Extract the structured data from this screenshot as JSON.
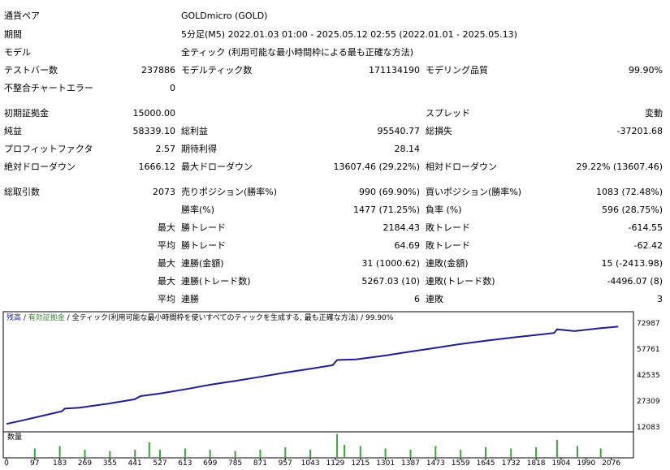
{
  "report": {
    "symbol": {
      "label": "通貨ペア",
      "value": "GOLDmicro (GOLD)"
    },
    "period": {
      "label": "期間",
      "value": "5分足(M5) 2022.01.03 01:00 - 2025.05.12 02:55 (2022.01.01 - 2025.05.13)"
    },
    "model": {
      "label": "モデル",
      "value": "全ティック (利用可能な最小時間枠による最も正確な方法)"
    },
    "bars": {
      "label": "テストバー数",
      "value": "237886"
    },
    "ticks": {
      "label": "モデルティック数",
      "value": "171134190"
    },
    "quality": {
      "label": "モデリング品質",
      "value": "99.90%"
    },
    "mismatch": {
      "label": "不整合チャートエラー",
      "value": "0"
    },
    "deposit": {
      "label": "初期証拠金",
      "value": "15000.00"
    },
    "spread": {
      "label": "スプレッド",
      "value": "変動"
    },
    "net_profit": {
      "label": "純益",
      "value": "58339.10"
    },
    "gross_profit": {
      "label": "総利益",
      "value": "95540.77"
    },
    "gross_loss": {
      "label": "総損失",
      "value": "-37201.68"
    },
    "profit_factor": {
      "label": "プロフィットファクタ",
      "value": "2.57"
    },
    "expected_payoff": {
      "label": "期待利得",
      "value": "28.14"
    },
    "abs_dd": {
      "label": "絶対ドローダウン",
      "value": "1666.12"
    },
    "max_dd": {
      "label": "最大ドローダウン",
      "value": "13607.46 (29.22%)"
    },
    "rel_dd": {
      "label": "相対ドローダウン",
      "value": "29.22% (13607.46)"
    },
    "total_trades": {
      "label": "総取引数",
      "value": "2073"
    },
    "short_pos": {
      "label": "売りポジション(勝率%)",
      "value": "990 (69.90%)"
    },
    "long_pos": {
      "label": "買いポジション(勝率%)",
      "value": "1083 (72.48%)"
    },
    "win_rate": {
      "label": "勝率(%)",
      "value": "1477 (71.25%)"
    },
    "loss_rate": {
      "label": "負率 (%)",
      "value": "596 (28.75%)"
    },
    "largest_win": {
      "prefix": "最大",
      "label": "勝トレード",
      "value": "2184.43"
    },
    "largest_loss": {
      "label": "敗トレード",
      "value": "-614.55"
    },
    "avg_win": {
      "prefix": "平均",
      "label": "勝トレード",
      "value": "64.69"
    },
    "avg_loss": {
      "label": "敗トレード",
      "value": "-62.42"
    },
    "max_consec_wins_amt": {
      "prefix": "最大",
      "label": "連勝(金額)",
      "value": "31 (1000.62)"
    },
    "max_consec_loss_amt": {
      "label": "連敗(金額)",
      "value": "15 (-2413.98)"
    },
    "max_consec_wins_cnt": {
      "prefix": "最大",
      "label": "連勝(トレード数)",
      "value": "5267.03 (10)"
    },
    "max_consec_loss_cnt": {
      "label": "連敗(トレード数)",
      "value": "-4496.07 (8)"
    },
    "avg_consec_wins": {
      "prefix": "平均",
      "label": "連勝",
      "value": "6"
    },
    "avg_consec_loss": {
      "label": "連敗",
      "value": "3"
    }
  },
  "chart": {
    "legend_balance": "残高",
    "legend_sep1": " / ",
    "legend_equity": "有効証拠金",
    "legend_sep2": " / ",
    "legend_model": "全ティック(利用可能な最小時間枠を使いすべてのティックを生成する, 最も正確な方法)",
    "legend_sep3": " / ",
    "legend_quality": "99.90%",
    "volume_label": "数量",
    "colors": {
      "balance": "#1e1e8c",
      "equity": "#2e8b2e",
      "volume": "#3aa63a",
      "axis": "#000000"
    }
  },
  "chart_data": {
    "type": "line",
    "y_ticks": [
      "72987",
      "57761",
      "42535",
      "27309",
      "12083"
    ],
    "x_ticks": [
      "0",
      "97",
      "183",
      "269",
      "355",
      "441",
      "527",
      "613",
      "699",
      "785",
      "871",
      "957",
      "1043",
      "1129",
      "1215",
      "1301",
      "1387",
      "1473",
      "1559",
      "1645",
      "1732",
      "1818",
      "1904",
      "1990",
      "2076"
    ],
    "ylim": [
      12083,
      80000
    ],
    "xlim": [
      0,
      2130
    ],
    "series": [
      {
        "x": [
          0,
          50,
          120,
          190,
          200,
          250,
          350,
          440,
          460,
          530,
          620,
          700,
          790,
          870,
          950,
          1040,
          1120,
          1135,
          1200,
          1300,
          1380,
          1460,
          1550,
          1640,
          1730,
          1810,
          1880,
          1890,
          1950,
          2040,
          2100
        ],
        "values": [
          14000,
          16000,
          19000,
          22000,
          23600,
          24200,
          26800,
          29500,
          31500,
          33200,
          36000,
          38700,
          41200,
          43600,
          46100,
          48600,
          51000,
          54200,
          54600,
          57000,
          59300,
          61500,
          64000,
          66200,
          68200,
          69800,
          71200,
          73500,
          72400,
          74300,
          75200
        ]
      }
    ],
    "volume_spikes": [
      {
        "x": 97,
        "v": 0.35
      },
      {
        "x": 183,
        "v": 0.45
      },
      {
        "x": 269,
        "v": 0.3
      },
      {
        "x": 355,
        "v": 0.25
      },
      {
        "x": 441,
        "v": 0.3
      },
      {
        "x": 490,
        "v": 0.6
      },
      {
        "x": 527,
        "v": 0.3
      },
      {
        "x": 613,
        "v": 0.35
      },
      {
        "x": 699,
        "v": 0.3
      },
      {
        "x": 785,
        "v": 0.25
      },
      {
        "x": 871,
        "v": 0.3
      },
      {
        "x": 957,
        "v": 0.4
      },
      {
        "x": 1043,
        "v": 0.3
      },
      {
        "x": 1135,
        "v": 0.95
      },
      {
        "x": 1160,
        "v": 0.5
      },
      {
        "x": 1215,
        "v": 0.45
      },
      {
        "x": 1301,
        "v": 0.35
      },
      {
        "x": 1387,
        "v": 0.3
      },
      {
        "x": 1473,
        "v": 0.45
      },
      {
        "x": 1559,
        "v": 0.3
      },
      {
        "x": 1645,
        "v": 0.4
      },
      {
        "x": 1732,
        "v": 0.35
      },
      {
        "x": 1818,
        "v": 0.4
      },
      {
        "x": 1890,
        "v": 0.7
      },
      {
        "x": 1960,
        "v": 0.45
      },
      {
        "x": 2040,
        "v": 0.35
      }
    ]
  }
}
